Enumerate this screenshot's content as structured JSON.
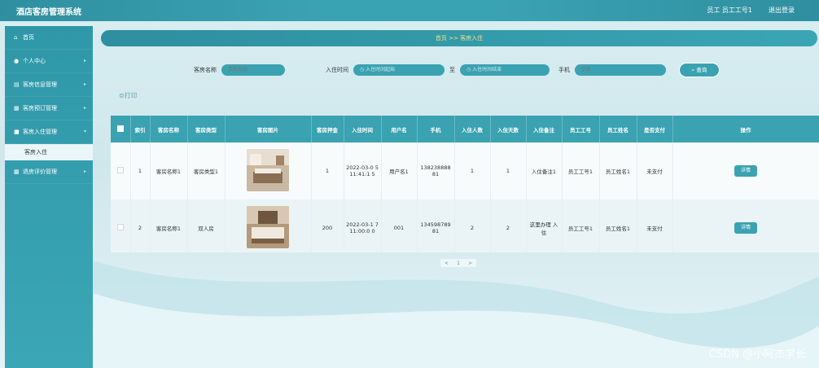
{
  "app": {
    "title": "酒店客房管理系统",
    "user": "员工 员工工号1",
    "logout": "退出登录"
  },
  "sidebar": {
    "items": [
      {
        "label": "首页"
      },
      {
        "label": "个人中心"
      },
      {
        "label": "客房信息管理"
      },
      {
        "label": "客房预订管理"
      },
      {
        "label": "客房入住管理"
      },
      {
        "label": "客房入住"
      },
      {
        "label": "退房评价管理"
      }
    ]
  },
  "breadcrumb": {
    "home": "首页",
    "sep": ">>",
    "current": "客房入住"
  },
  "search": {
    "room_label": "客房名称",
    "room_placeholder": "客房名称",
    "time_label": "入住时间",
    "time_start": "入住时间起始",
    "to": "至",
    "time_end": "入住时间结束",
    "phone_label": "手机",
    "phone_placeholder": "手机",
    "query": "查询"
  },
  "print": "打印",
  "table": {
    "headers": [
      "",
      "索引",
      "客房名称",
      "客房类型",
      "客房图片",
      "客房押金",
      "入住时间",
      "用户名",
      "手机",
      "入住人数",
      "入住天数",
      "入住备注",
      "员工工号",
      "员工姓名",
      "是否支付",
      "操作"
    ],
    "rows": [
      {
        "index": "1",
        "name": "客房名称1",
        "type": "客房类型1",
        "deposit": "1",
        "time": "2022-03-0 5 11:41:1 5",
        "user": "用户名1",
        "phone": "138238888 81",
        "people": "1",
        "days": "1",
        "note": "入住备注1",
        "empno": "员工工号1",
        "empname": "员工姓名1",
        "paid": "未支付",
        "action": "详情"
      },
      {
        "index": "2",
        "name": "客房名称1",
        "type": "双人房",
        "deposit": "200",
        "time": "2022-03-1 7 11:00:0 0",
        "user": "001",
        "phone": "134598789 81",
        "people": "2",
        "days": "2",
        "note": "这里办理 入住",
        "empno": "员工工号1",
        "empname": "员工姓名1",
        "paid": "未支付",
        "action": "详情"
      }
    ]
  },
  "pager": {
    "prev": "<",
    "page": "1",
    "next": ">"
  },
  "watermark": "CSDN @小阿杰学长",
  "colors": {
    "teal": "#3aa2b1",
    "crumb_text": "#f2e28a"
  }
}
